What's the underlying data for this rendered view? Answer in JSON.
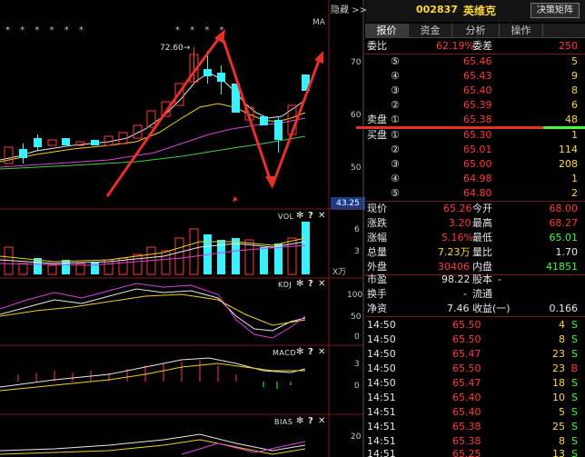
{
  "top_bar": {
    "hide_label": "隐藏 >>",
    "stock_code": "002837",
    "stock_name": "英维克",
    "decision_button": "决策矩阵"
  },
  "tabs": [
    {
      "label": "报价",
      "active": true
    },
    {
      "label": "资金",
      "active": false
    },
    {
      "label": "分析",
      "active": false
    },
    {
      "label": "操作",
      "active": false
    }
  ],
  "chart": {
    "ma_label": "MA",
    "stars_left": "* *   * * * *",
    "stars_right": "* * * *",
    "high_annotation": "72.60→",
    "price_axis": [
      "70",
      "60",
      "50"
    ],
    "current_price_tag": "43.25",
    "vol_label": "VOL",
    "vol_axis": [
      "6",
      "3"
    ],
    "vol_unit": "X万",
    "kdj_label": "KDJ",
    "kdj_axis": [
      "100",
      "50",
      "0"
    ],
    "macd_label": "MACD",
    "macd_axis": [
      "3",
      "0"
    ],
    "bias_label": "BIAS",
    "bias_axis": [
      "20"
    ],
    "panel_icons": {
      "gear": "✻",
      "up": "⬆",
      "help": "?",
      "close": "✕"
    }
  },
  "weibi": {
    "label": "委比",
    "value": "62.19%",
    "diff_label": "委差",
    "diff_value": "250"
  },
  "sell_orders": [
    {
      "label": "",
      "level": "⑤",
      "price": "65.46",
      "vol": "5"
    },
    {
      "label": "",
      "level": "④",
      "price": "65.43",
      "vol": "9"
    },
    {
      "label": "",
      "level": "③",
      "price": "65.40",
      "vol": "8"
    },
    {
      "label": "",
      "level": "②",
      "price": "65.39",
      "vol": "6"
    },
    {
      "label": "卖盘",
      "level": "①",
      "price": "65.38",
      "vol": "48"
    }
  ],
  "buy_orders": [
    {
      "label": "买盘",
      "level": "①",
      "price": "65.30",
      "vol": "1"
    },
    {
      "label": "",
      "level": "②",
      "price": "65.01",
      "vol": "114"
    },
    {
      "label": "",
      "level": "③",
      "price": "65.00",
      "vol": "208"
    },
    {
      "label": "",
      "level": "④",
      "price": "64.98",
      "vol": "1"
    },
    {
      "label": "",
      "level": "⑤",
      "price": "64.80",
      "vol": "2"
    }
  ],
  "quote": [
    {
      "l1": "现价",
      "v1": "65.26",
      "l2": "今开",
      "v2": "68.00"
    },
    {
      "l1": "涨跌",
      "v1": "3.20",
      "l2": "最高",
      "v2": "68.27"
    },
    {
      "l1": "涨幅",
      "v1": "5.16%",
      "l2": "最低",
      "v2": "65.01"
    },
    {
      "l1": "总量",
      "v1": "7.23万",
      "l2": "量比",
      "v2": "1.70"
    },
    {
      "l1": "外盘",
      "v1": "30406",
      "l2": "内盘",
      "v2": "41851"
    }
  ],
  "fundamentals": [
    {
      "l1": "市盈",
      "v1": "98.22",
      "l2": "股本",
      "v2": "-"
    },
    {
      "l1": "换手",
      "v1": "-",
      "l2": "流通",
      "v2": "-"
    },
    {
      "l1": "净资",
      "v1": "7.46",
      "l2": "收益(一)",
      "v2": "0.166"
    }
  ],
  "ticks": [
    {
      "time": "14:50",
      "price": "65.50",
      "vol": "4",
      "side": "S"
    },
    {
      "time": "14:50",
      "price": "65.50",
      "vol": "8",
      "side": "S"
    },
    {
      "time": "14:50",
      "price": "65.47",
      "vol": "23",
      "side": "S"
    },
    {
      "time": "14:50",
      "price": "65.50",
      "vol": "23",
      "side": "B"
    },
    {
      "time": "14:50",
      "price": "65.47",
      "vol": "18",
      "side": "S"
    },
    {
      "time": "14:51",
      "price": "65.40",
      "vol": "10",
      "side": "S"
    },
    {
      "time": "14:51",
      "price": "65.40",
      "vol": "5",
      "side": "S"
    },
    {
      "time": "14:51",
      "price": "65.38",
      "vol": "25",
      "side": "S"
    },
    {
      "time": "14:51",
      "price": "65.38",
      "vol": "8",
      "side": "S"
    },
    {
      "time": "14:51",
      "price": "65.25",
      "vol": "13",
      "side": "S"
    }
  ],
  "colors": {
    "up": "#ff3b3b",
    "down": "#3aff3a",
    "volume_cyan": "#3af0ff",
    "arrow_red": "#e8302a"
  }
}
